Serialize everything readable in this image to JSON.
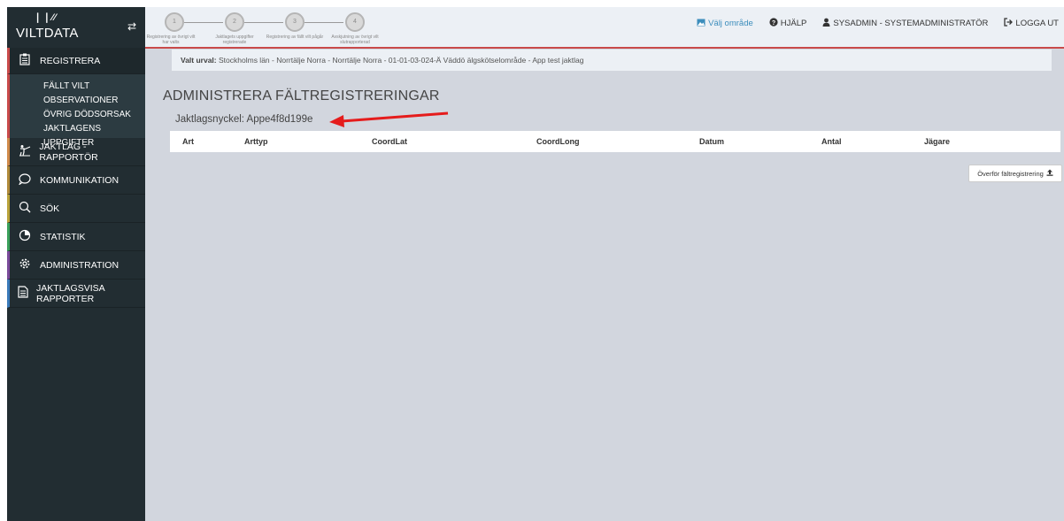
{
  "brand": {
    "logo_text": "VILTDATA",
    "toggle_icon": "exchange-icon"
  },
  "steps": [
    {
      "num": "1",
      "label": "Registrering av övrigt vilt har valts"
    },
    {
      "num": "2",
      "label": "Jaktlagets uppgifter registrerade"
    },
    {
      "num": "3",
      "label": "Registrering av fällt vilt pågår"
    },
    {
      "num": "4",
      "label": "Avskjutning av övrigt vilt slutrapporterad"
    }
  ],
  "topnav": {
    "area": "Välj område",
    "help": "HJÄLP",
    "user": "SYSADMIN - SYSTEMADMINISTRATÖR",
    "logout": "LOGGA UT"
  },
  "sidebar": {
    "registrera": "REGISTRERA",
    "sub": [
      "FÄLLT VILT",
      "OBSERVATIONER",
      "ÖVRIG DÖDSORSAK",
      "JAKTLAGENS UPPGIFTER"
    ],
    "items": [
      {
        "label": "JAKTLAG - RAPPORTÖR",
        "icon": "hunter-icon"
      },
      {
        "label": "KOMMUNIKATION",
        "icon": "chat-icon"
      },
      {
        "label": "SÖK",
        "icon": "search-icon"
      },
      {
        "label": "STATISTIK",
        "icon": "pie-chart-icon"
      },
      {
        "label": "ADMINISTRATION",
        "icon": "gear-icon"
      },
      {
        "label": "JAKTLAGSVISA RAPPORTER",
        "icon": "document-icon"
      }
    ]
  },
  "urval": {
    "label": "Valt urval:",
    "value": "Stockholms län - Norrtälje Norra - Norrtälje Norra - 01-01-03-024-Ä Väddö älgskötselområde - App test jaktlag"
  },
  "page_title": "ADMINISTRERA FÄLTREGISTRERINGAR",
  "key_label": "Jaktlagsnyckel: Appe4f8d199e",
  "table": {
    "headers": [
      "Art",
      "Arttyp",
      "CoordLat",
      "CoordLong",
      "Datum",
      "Antal",
      "Jägare"
    ]
  },
  "transfer_button": "Överför fältregistrering",
  "colors": {
    "sidebar": "#222d32",
    "accent": "#c94a4a",
    "content_bg": "#d2d6de",
    "link": "#3c8dbc"
  }
}
